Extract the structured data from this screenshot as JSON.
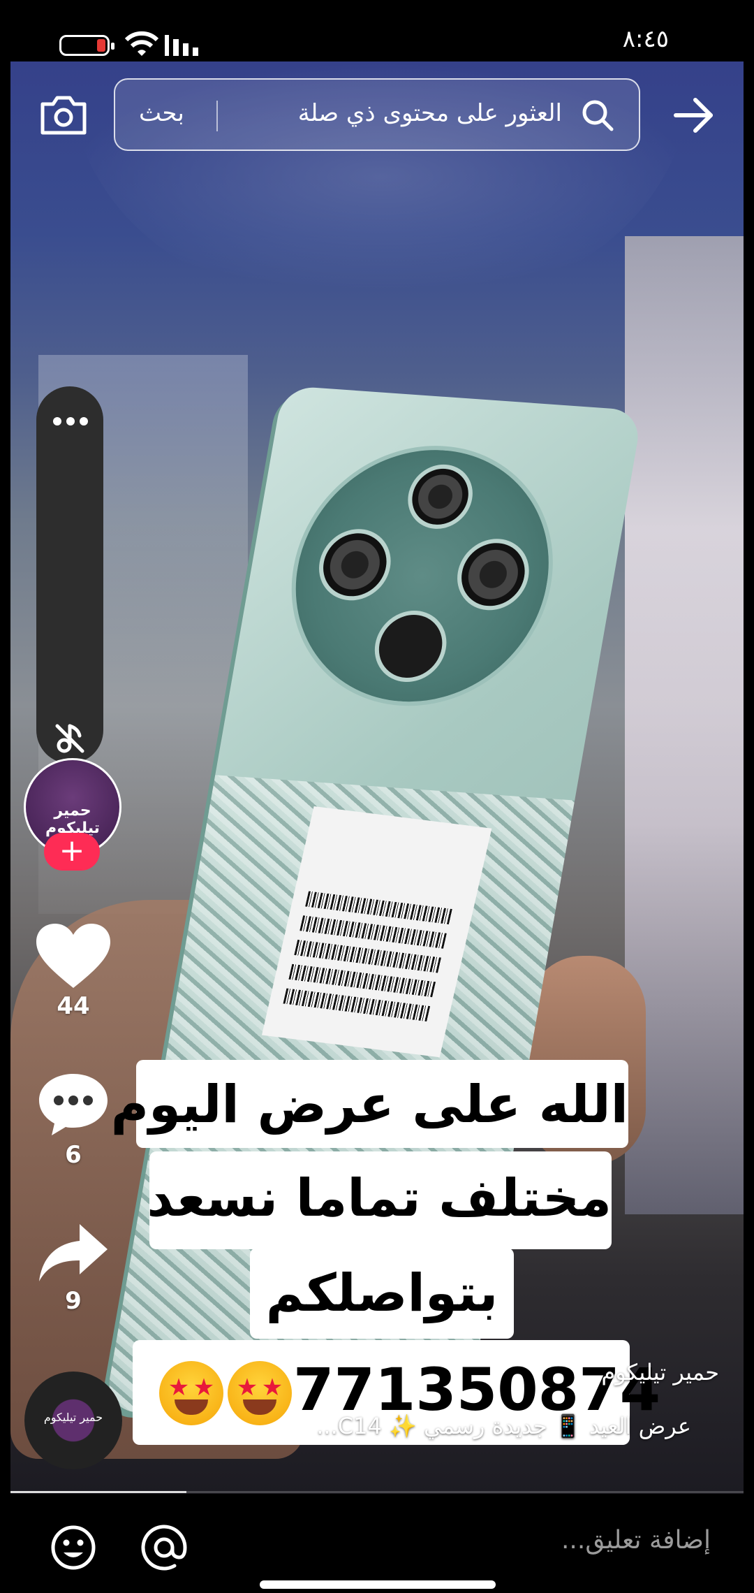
{
  "status_bar": {
    "time": "٨:٤٥",
    "battery_level": 0.12
  },
  "search": {
    "placeholder": "العثور على محتوى ذي صلة",
    "button_label": "بحث"
  },
  "profile": {
    "name": "حمير تيليكوم"
  },
  "actions": {
    "likes": "44",
    "comments": "6",
    "shares": "9"
  },
  "caption": {
    "line1": "الله على عرض اليوم",
    "line2": "مختلف تماما نسعد",
    "line3": "بتواصلكم",
    "phone": "771350874"
  },
  "description": {
    "author": "حمير تيليكوم",
    "text": "عرض العيد 📱 جديدة رسمي ✨ C14..."
  },
  "progress": 0.24,
  "comment_bar": {
    "placeholder": "إضافة تعليق..."
  },
  "colors": {
    "accent": "#fe2c55",
    "battery_low": "#e53935"
  },
  "icons": {
    "camera": "camera-icon",
    "search": "search-icon",
    "back": "arrow-right-icon",
    "more": "more-dots-icon",
    "mute": "mute-icon",
    "like": "heart-icon",
    "comment": "comment-icon",
    "share": "share-icon",
    "emoji": "emoji-icon",
    "mention": "at-icon"
  }
}
